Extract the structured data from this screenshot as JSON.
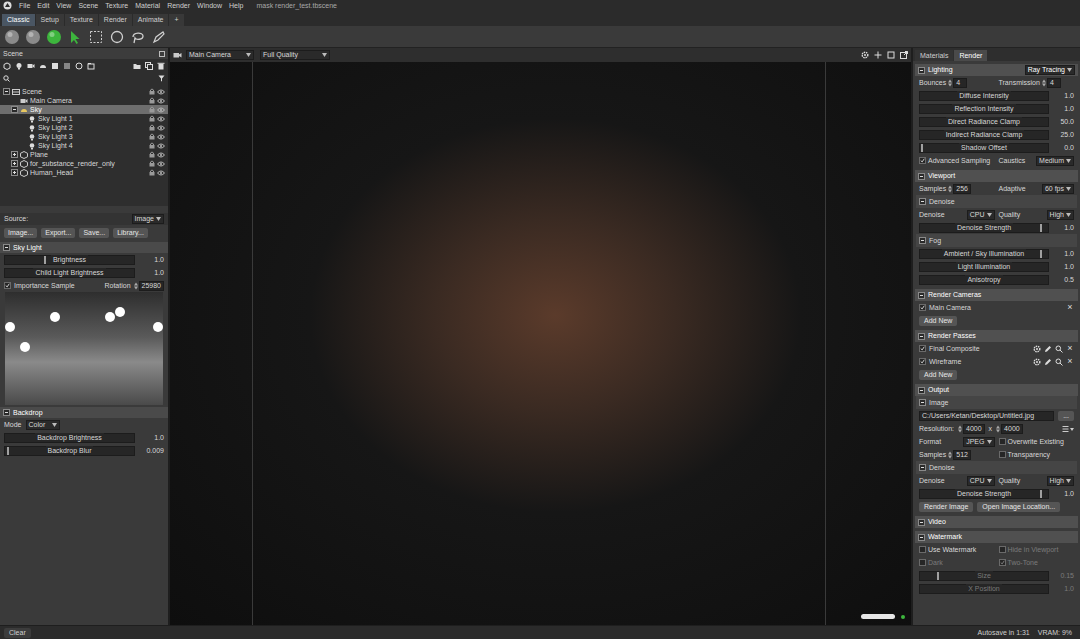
{
  "window": {
    "title": "mask render_test.tbscene"
  },
  "menu": [
    "File",
    "Edit",
    "View",
    "Scene",
    "Texture",
    "Material",
    "Render",
    "Window",
    "Help"
  ],
  "mode_tabs": [
    {
      "label": "Classic",
      "selected": true
    },
    {
      "label": "Setup",
      "selected": false
    },
    {
      "label": "Texture",
      "selected": false
    },
    {
      "label": "Render",
      "selected": false
    },
    {
      "label": "Animate",
      "selected": false
    },
    {
      "label": "+",
      "selected": false
    }
  ],
  "toolbar": {
    "tools": [
      {
        "kind": "sphere",
        "selected": false
      },
      {
        "kind": "sphere",
        "selected": false
      },
      {
        "kind": "sphere",
        "selected": true
      },
      {
        "kind": "select",
        "selected": true
      },
      {
        "kind": "rect",
        "selected": false
      },
      {
        "kind": "circle",
        "selected": false
      },
      {
        "kind": "lasso",
        "selected": false
      },
      {
        "kind": "pen",
        "selected": false
      }
    ]
  },
  "scene_panel": {
    "title": "Scene",
    "tree": [
      {
        "label": "Scene",
        "kind": "scene",
        "expanded": true,
        "selected": false,
        "children": [
          {
            "label": "Main Camera",
            "kind": "camera",
            "selected": false
          },
          {
            "label": "Sky",
            "kind": "sky",
            "expanded": true,
            "selected": true,
            "children": [
              {
                "label": "Sky Light 1",
                "kind": "light",
                "selected": false
              },
              {
                "label": "Sky Light 2",
                "kind": "light",
                "selected": false
              },
              {
                "label": "Sky Light 3",
                "kind": "light",
                "selected": false
              },
              {
                "label": "Sky Light 4",
                "kind": "light",
                "selected": false
              }
            ]
          },
          {
            "label": "Plane",
            "kind": "mesh",
            "expanded": false,
            "selected": false
          },
          {
            "label": "for_substance_render_only",
            "kind": "mesh",
            "expanded": false,
            "selected": false
          },
          {
            "label": "Human_Head",
            "kind": "mesh",
            "expanded": false,
            "selected": false
          }
        ]
      }
    ]
  },
  "source": {
    "label": "Source:",
    "value": "Image",
    "buttons": [
      "Image...",
      "Export...",
      "Save...",
      "Library..."
    ]
  },
  "sky_light": {
    "title": "Sky Light",
    "sliders": [
      {
        "label": "Brightness",
        "value": "1.0",
        "level": 0.32
      },
      {
        "label": "Child Light Brightness",
        "value": "1.0",
        "level": 0.27
      }
    ],
    "importance_sample": {
      "label": "Importance Sample",
      "checked": true
    },
    "rotation": {
      "label": "Rotation",
      "value": "25980"
    }
  },
  "backdrop": {
    "title": "Backdrop",
    "mode": {
      "label": "Mode",
      "value": "Color"
    },
    "sliders": [
      {
        "label": "Backdrop Brightness",
        "value": "1.0",
        "level": 0.32
      },
      {
        "label": "Backdrop Blur",
        "value": "0.009",
        "level": 0.03
      }
    ]
  },
  "viewport": {
    "camera": "Main Camera",
    "quality": "Full Quality"
  },
  "right_panel": {
    "tabs": [
      {
        "label": "Materials",
        "selected": false
      },
      {
        "label": "Render",
        "selected": true
      }
    ],
    "sections": [
      {
        "title": "Lighting",
        "select": "Ray Tracing",
        "rows": [
          {
            "kind": "fields",
            "cells": [
              {
                "kind": "spin",
                "label": "Bounces",
                "value": "4"
              },
              {
                "kind": "spin",
                "label": "Transmission",
                "value": "4"
              }
            ]
          },
          {
            "kind": "slider",
            "label": "Diffuse Intensity",
            "value": "1.0",
            "level": 0.43,
            "disabled": false
          },
          {
            "kind": "slider",
            "label": "Reflection Intensity",
            "value": "1.0",
            "level": 0.48,
            "disabled": false
          },
          {
            "kind": "slider",
            "label": "Direct Radiance Clamp",
            "value": "50.0",
            "level": 0.55,
            "disabled": false
          },
          {
            "kind": "slider",
            "label": "Indirect Radiance Clamp",
            "value": "25.0",
            "level": 0.55,
            "disabled": false
          },
          {
            "kind": "slider",
            "label": "Shadow Offset",
            "value": "0.0",
            "level": 0.02,
            "disabled": false
          },
          {
            "kind": "fields",
            "cells": [
              {
                "kind": "check",
                "label": "Advanced Sampling",
                "checked": true,
                "disabled": false
              },
              {
                "kind": "select",
                "label": "Caustics",
                "value": "Medium"
              }
            ]
          }
        ]
      },
      {
        "title": "Viewport",
        "rows": [
          {
            "kind": "fields",
            "cells": [
              {
                "kind": "spin",
                "label": "Samples",
                "value": "256"
              },
              {
                "kind": "select",
                "label": "Adaptive",
                "value": "60 fps"
              }
            ]
          },
          {
            "kind": "subheader",
            "label": "Denoise"
          },
          {
            "kind": "fields",
            "cells": [
              {
                "kind": "select",
                "label": "Denoise",
                "value": "CPU"
              },
              {
                "kind": "select",
                "label": "Quality",
                "value": "High"
              }
            ]
          },
          {
            "kind": "slider",
            "label": "Denoise Strength",
            "value": "1.0",
            "level": 0.95,
            "disabled": false
          },
          {
            "kind": "subheader",
            "label": "Fog"
          },
          {
            "kind": "slider",
            "label": "Ambient / Sky Illumination",
            "value": "1.0",
            "level": 0.95,
            "disabled": false
          },
          {
            "kind": "slider",
            "label": "Light Illumination",
            "value": "1.0",
            "level": 0.4,
            "disabled": false
          },
          {
            "kind": "slider",
            "label": "Anisotropy",
            "value": "0.5",
            "level": 0.6,
            "disabled": false
          }
        ]
      },
      {
        "title": "Render Cameras",
        "rows": [
          {
            "kind": "camera-item",
            "label": "Main Camera",
            "checked": true,
            "remove": "×"
          },
          {
            "kind": "button",
            "label": "Add New"
          }
        ]
      },
      {
        "title": "Render Passes",
        "rows": [
          {
            "kind": "pass-item",
            "label": "Final Composite",
            "checked": true,
            "remove": "×"
          },
          {
            "kind": "pass-item",
            "label": "Wireframe",
            "checked": true,
            "remove": "×"
          },
          {
            "kind": "button",
            "label": "Add New"
          }
        ]
      },
      {
        "title": "Output",
        "rows": [
          {
            "kind": "subheader",
            "label": "Image"
          },
          {
            "kind": "fields",
            "cells": [
              {
                "kind": "field",
                "value": "C:/Users/Ketan/Desktop/Untitled.jpg"
              },
              {
                "kind": "button",
                "label": "..."
              }
            ]
          },
          {
            "kind": "fields",
            "cells": [
              {
                "kind": "label",
                "label": "Resolution:"
              },
              {
                "kind": "spin",
                "value": "4000"
              },
              {
                "kind": "label",
                "label": "x"
              },
              {
                "kind": "spin",
                "value": "4000"
              },
              {
                "kind": "preset"
              }
            ]
          },
          {
            "kind": "fields",
            "cells": [
              {
                "kind": "select",
                "label": "Format",
                "value": "JPEG"
              },
              {
                "kind": "check",
                "label": "Overwrite Existing",
                "checked": false,
                "disabled": false
              }
            ]
          },
          {
            "kind": "fields",
            "cells": [
              {
                "kind": "spin",
                "label": "Samples",
                "value": "512"
              },
              {
                "kind": "check",
                "label": "Transparency",
                "checked": false,
                "disabled": false
              }
            ]
          },
          {
            "kind": "subheader",
            "label": "Denoise"
          },
          {
            "kind": "fields",
            "cells": [
              {
                "kind": "select",
                "label": "Denoise",
                "value": "CPU"
              },
              {
                "kind": "select",
                "label": "Quality",
                "value": "High"
              }
            ]
          },
          {
            "kind": "slider",
            "label": "Denoise Strength",
            "value": "1.0",
            "level": 0.95,
            "disabled": false
          },
          {
            "kind": "fields",
            "cells": [
              {
                "kind": "button",
                "label": "Render Image"
              },
              {
                "kind": "button",
                "label": "Open Image Location..."
              }
            ]
          }
        ]
      },
      {
        "title": "Video",
        "rows": []
      },
      {
        "title": "Watermark",
        "rows": [
          {
            "kind": "fields",
            "cells": [
              {
                "kind": "check",
                "label": "Use Watermark",
                "checked": false,
                "disabled": false
              },
              {
                "kind": "check",
                "label": "Hide in Viewport",
                "checked": false,
                "disabled": true
              }
            ]
          },
          {
            "kind": "fields",
            "cells": [
              {
                "kind": "check",
                "label": "Dark",
                "checked": false,
                "disabled": true
              },
              {
                "kind": "check",
                "label": "Two-Tone",
                "checked": true,
                "disabled": true
              }
            ]
          },
          {
            "kind": "slider",
            "label": "Size",
            "value": "0.15",
            "level": 0.15,
            "disabled": true
          },
          {
            "kind": "slider",
            "label": "X Position",
            "value": "1.0",
            "level": 0.5,
            "disabled": true
          }
        ]
      }
    ]
  },
  "status_bar": {
    "clear": "Clear",
    "autosave": "Autosave in 1:31",
    "vram": "VRAM: 9%"
  }
}
